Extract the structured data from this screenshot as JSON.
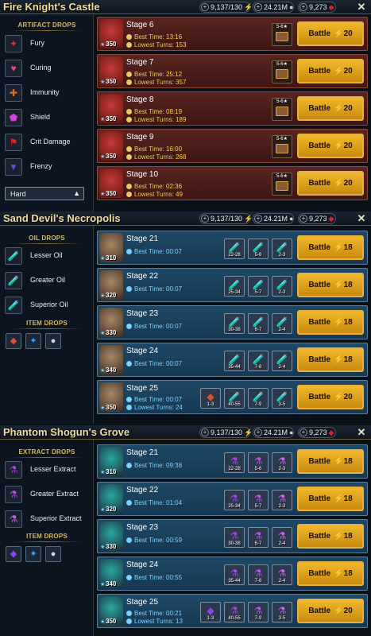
{
  "panels": [
    {
      "title": "Fire Knight's Castle",
      "energy": "9,137/130",
      "silver": "24.21M",
      "gems": "9,273",
      "sidebar": {
        "heading": "ARTIFACT DROPS",
        "items": [
          {
            "label": "Fury",
            "icon": "fury-set-icon"
          },
          {
            "label": "Curing",
            "icon": "curing-set-icon"
          },
          {
            "label": "Immunity",
            "icon": "immunity-set-icon"
          },
          {
            "label": "Shield",
            "icon": "shield-set-icon"
          },
          {
            "label": "Crit Damage",
            "icon": "crit-damage-set-icon"
          },
          {
            "label": "Frenzy",
            "icon": "frenzy-set-icon"
          }
        ],
        "difficulty": "Hard"
      },
      "stages": [
        {
          "name": "Stage 6",
          "level": "350",
          "best_label": "Best Time:",
          "best": "13:16",
          "turns_label": "Lowest Turns:",
          "turns": "153",
          "chest_range": "5-6★",
          "battle": "Battle",
          "energy": "20"
        },
        {
          "name": "Stage 7",
          "level": "350",
          "best_label": "Best Time:",
          "best": "25:12",
          "turns_label": "Lowest Turns:",
          "turns": "357",
          "chest_range": "5-6★",
          "battle": "Battle",
          "energy": "20"
        },
        {
          "name": "Stage 8",
          "level": "350",
          "best_label": "Best Time:",
          "best": "08:19",
          "turns_label": "Lowest Turns:",
          "turns": "189",
          "chest_range": "5-6★",
          "battle": "Battle",
          "energy": "20"
        },
        {
          "name": "Stage 9",
          "level": "350",
          "best_label": "Best Time:",
          "best": "16:00",
          "turns_label": "Lowest Turns:",
          "turns": "268",
          "chest_range": "5-6★",
          "battle": "Battle",
          "energy": "20"
        },
        {
          "name": "Stage 10",
          "level": "350",
          "best_label": "Best Time:",
          "best": "02:36",
          "turns_label": "Lowest Turns:",
          "turns": "49",
          "chest_range": "5-6★",
          "battle": "Battle",
          "energy": "20"
        }
      ]
    },
    {
      "title": "Sand Devil's Necropolis",
      "energy": "9,137/130",
      "silver": "24.21M",
      "gems": "9,273",
      "sidebar": {
        "heading": "OIL DROPS",
        "items": [
          {
            "label": "Lesser Oil",
            "icon": "lesser-oil-icon"
          },
          {
            "label": "Greater Oil",
            "icon": "greater-oil-icon"
          },
          {
            "label": "Superior Oil",
            "icon": "superior-oil-icon"
          }
        ],
        "heading2": "ITEM DROPS"
      },
      "stages": [
        {
          "name": "Stage 21",
          "level": "310",
          "best_label": "Best Time:",
          "best": "00:07",
          "drops": [
            "22-28",
            "5-6",
            "2-3"
          ],
          "battle": "Battle",
          "energy": "18"
        },
        {
          "name": "Stage 22",
          "level": "320",
          "best_label": "Best Time:",
          "best": "00:07",
          "drops": [
            "25-34",
            "5-7",
            "2-3"
          ],
          "battle": "Battle",
          "energy": "18"
        },
        {
          "name": "Stage 23",
          "level": "330",
          "best_label": "Best Time:",
          "best": "00:07",
          "drops": [
            "30-38",
            "6-7",
            "2-4"
          ],
          "battle": "Battle",
          "energy": "18"
        },
        {
          "name": "Stage 24",
          "level": "340",
          "best_label": "Best Time:",
          "best": "00:07",
          "drops": [
            "35-44",
            "7-8",
            "2-4"
          ],
          "battle": "Battle",
          "energy": "18"
        },
        {
          "name": "Stage 25",
          "level": "350",
          "best_label": "Best Time:",
          "best": "00:07",
          "turns_label": "Lowest Turns:",
          "turns": "24",
          "drops": [
            "1-3",
            "40-55",
            "7-9",
            "3-5"
          ],
          "battle": "Battle",
          "energy": "20"
        }
      ]
    },
    {
      "title": "Phantom Shogun's Grove",
      "energy": "9,137/130",
      "silver": "24.21M",
      "gems": "9,273",
      "sidebar": {
        "heading": "EXTRACT DROPS",
        "items": [
          {
            "label": "Lesser Extract",
            "icon": "lesser-extract-icon"
          },
          {
            "label": "Greater Extract",
            "icon": "greater-extract-icon"
          },
          {
            "label": "Superior Extract",
            "icon": "superior-extract-icon"
          }
        ],
        "heading2": "ITEM DROPS"
      },
      "stages": [
        {
          "name": "Stage 21",
          "level": "310",
          "best_label": "Best Time:",
          "best": "09:38",
          "drops": [
            "22-28",
            "5-6",
            "2-3"
          ],
          "battle": "Battle",
          "energy": "18"
        },
        {
          "name": "Stage 22",
          "level": "320",
          "best_label": "Best Time:",
          "best": "01:04",
          "drops": [
            "25-34",
            "5-7",
            "2-3"
          ],
          "battle": "Battle",
          "energy": "18"
        },
        {
          "name": "Stage 23",
          "level": "330",
          "best_label": "Best Time:",
          "best": "00:59",
          "drops": [
            "30-38",
            "6-7",
            "2-4"
          ],
          "battle": "Battle",
          "energy": "18"
        },
        {
          "name": "Stage 24",
          "level": "340",
          "best_label": "Best Time:",
          "best": "00:55",
          "drops": [
            "35-44",
            "7-8",
            "2-4"
          ],
          "battle": "Battle",
          "energy": "18"
        },
        {
          "name": "Stage 25",
          "level": "350",
          "best_label": "Best Time:",
          "best": "00:21",
          "turns_label": "Lowest Turns:",
          "turns": "13",
          "drops": [
            "1-3",
            "40-55",
            "7-9",
            "3-5"
          ],
          "battle": "Battle",
          "energy": "20"
        }
      ]
    }
  ],
  "icons": {
    "energy": "lightning-bolt-icon",
    "silver": "silver-coin-icon",
    "gems": "ruby-gem-icon",
    "close": "close-icon",
    "plus": "plus-icon"
  },
  "colors": {
    "battle_button": "#f0b82a",
    "fire_row": "#5a2420",
    "blue_row": "#1e4866",
    "gold_text": "#d8b860"
  }
}
